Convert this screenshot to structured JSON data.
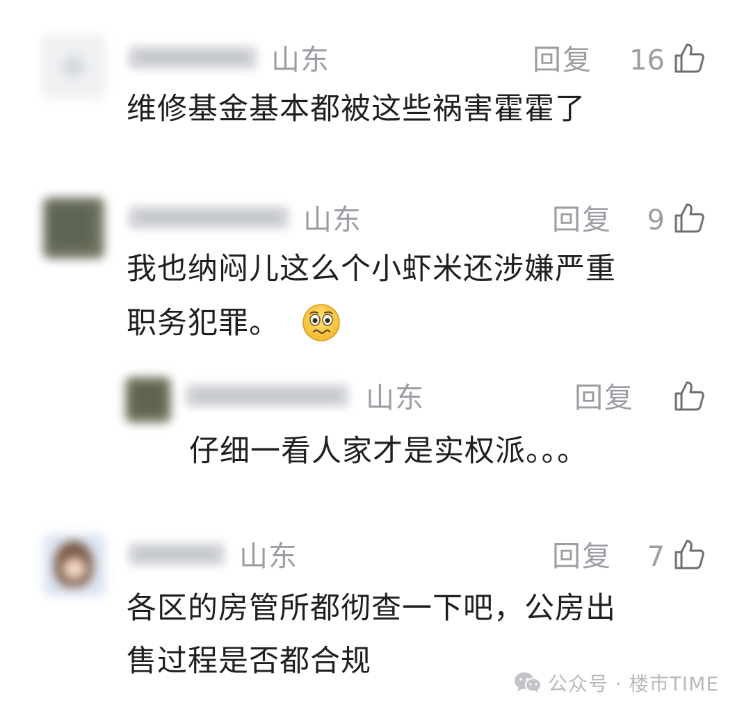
{
  "comments": [
    {
      "region": "山东",
      "reply": "回复",
      "likes": "16",
      "content": "维修基金基本都被这些祸害霍霍了"
    },
    {
      "region": "山东",
      "reply": "回复",
      "likes": "9",
      "content_line1": "我也纳闷儿这么个小虾米还涉嫌严重",
      "content_line2": "职务犯罪。",
      "emoji": "worried-face-emoji"
    },
    {
      "region": "山东",
      "reply": "回复",
      "likes": "",
      "content": "仔细一看人家才是实权派。。。"
    },
    {
      "region": "山东",
      "reply": "回复",
      "likes": "7",
      "content_line1": "各区的房管所都彻查一下吧，公房出",
      "content_line2": "售过程是否都合规"
    }
  ],
  "watermark": {
    "text": "公众号 · 楼市TIME",
    "icon": "wechat-icon"
  },
  "colors": {
    "meta_gray": "#9b9ea3",
    "text_dark": "#1f1f1f"
  }
}
